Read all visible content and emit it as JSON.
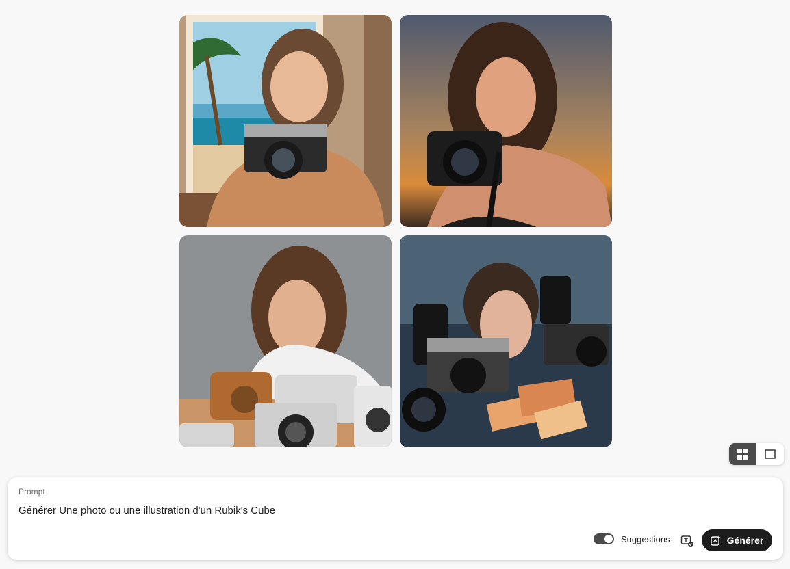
{
  "gallery": {
    "images": [
      {
        "name": "woman-retro-camera-beach"
      },
      {
        "name": "woman-dslr-sunset"
      },
      {
        "name": "woman-vintage-cameras-table"
      },
      {
        "name": "woman-cameras-photos-dark"
      }
    ]
  },
  "view_toggle": {
    "grid_icon": "grid-view-icon",
    "single_icon": "single-view-icon",
    "active": "grid"
  },
  "prompt": {
    "label": "Prompt",
    "value": "Générer Une photo ou une illustration d'un Rubik's Cube",
    "suggestions_label": "Suggestions",
    "suggestions_enabled": true,
    "generate_label": "Générer"
  },
  "colors": {
    "background": "#f8f8f8",
    "button": "#1d1d1d",
    "toggle_active": "#4b4b4b"
  }
}
